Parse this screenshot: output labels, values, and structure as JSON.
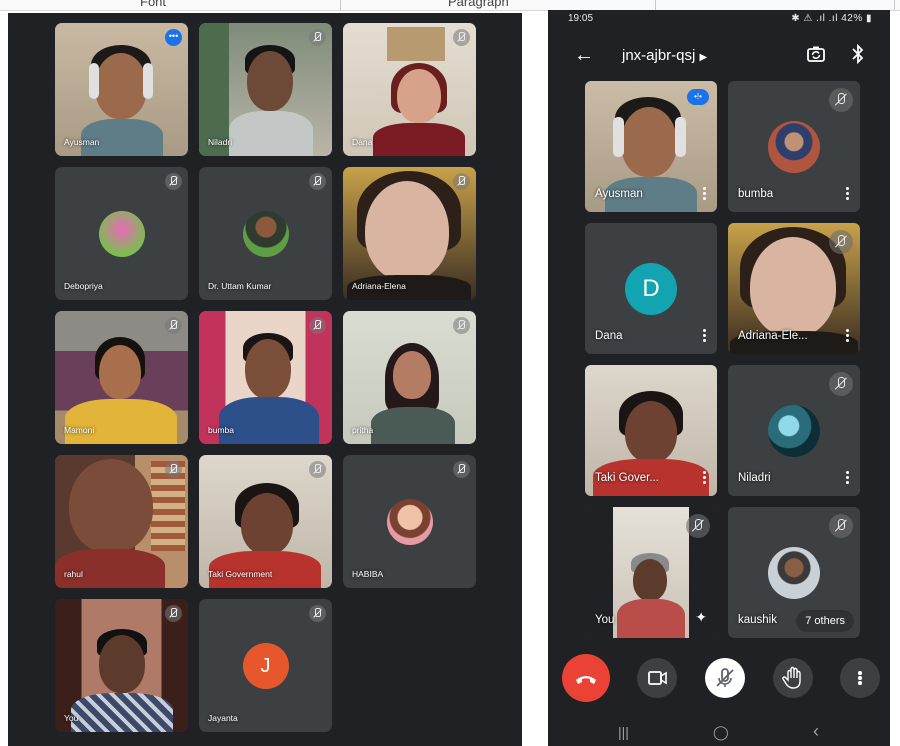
{
  "ribbon": {
    "left_label": "Font",
    "right_label": "Paragraph"
  },
  "desktop": {
    "tiles": [
      {
        "name": "Ayusman"
      },
      {
        "name": "Niladri"
      },
      {
        "name": "Dana"
      },
      {
        "name": "Debopriya"
      },
      {
        "name": "Dr. Uttam Kumar"
      },
      {
        "name": "Adriana-Elena"
      },
      {
        "name": "Mamoni"
      },
      {
        "name": "bumba"
      },
      {
        "name": "pritha"
      },
      {
        "name": "rahul"
      },
      {
        "name": "Taki Government"
      },
      {
        "name": "HABIBA"
      },
      {
        "name": "You"
      },
      {
        "name": "Jayanta",
        "initial": "J"
      }
    ]
  },
  "phone": {
    "status": {
      "time": "19:05",
      "system": "✱ ⚠ .ıl .ıl 42% ▮"
    },
    "meeting_code": "jnx-ajbr-qsj",
    "tiles": [
      {
        "name": "Ayusman"
      },
      {
        "name": "bumba"
      },
      {
        "name": "Dana",
        "initial": "D"
      },
      {
        "name": "Adriana-Ele..."
      },
      {
        "name": "Taki Gover..."
      },
      {
        "name": "Niladri"
      },
      {
        "name": "You"
      },
      {
        "name": "kaushik"
      }
    ],
    "others_label": "7 others",
    "nav": {
      "recent": "|||",
      "home": "◯",
      "back": "‹"
    }
  },
  "colors": {
    "background": "#202124",
    "tile": "#3c4043",
    "accent_blue": "#1a73e8",
    "end_call_red": "#ea4335",
    "jayanta_orange": "#e8562c",
    "dana_teal": "#12a4b0"
  },
  "icons": [
    "mic-off-icon",
    "more-options-icon",
    "back-arrow-icon",
    "switch-camera-icon",
    "bluetooth-icon",
    "end-call-icon",
    "camera-icon",
    "raise-hand-icon",
    "sparkle-icon"
  ]
}
